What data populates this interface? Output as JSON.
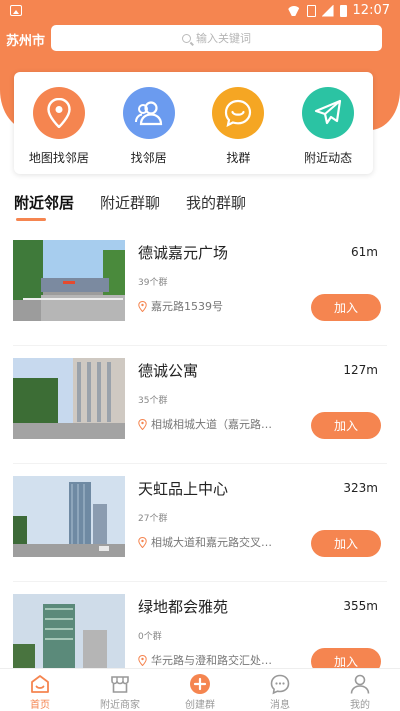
{
  "status": {
    "time": "12:07"
  },
  "header": {
    "city": "苏州市",
    "search_placeholder": "输入关键词"
  },
  "features": [
    {
      "label": "地图找邻居",
      "icon": "map-pin-icon",
      "color": "#f58550"
    },
    {
      "label": "找邻居",
      "icon": "users-icon",
      "color": "#6b9bef"
    },
    {
      "label": "找群",
      "icon": "smile-icon",
      "color": "#f5a623"
    },
    {
      "label": "附近动态",
      "icon": "paper-plane-icon",
      "color": "#2bc3a3"
    }
  ],
  "tabs": [
    {
      "label": "附近邻居",
      "active": true
    },
    {
      "label": "附近群聊",
      "active": false
    },
    {
      "label": "我的群聊",
      "active": false
    }
  ],
  "items": [
    {
      "name": "德诚嘉元广场",
      "distance": "61m",
      "groups": "39个群",
      "address": "嘉元路1539号",
      "join": "加入"
    },
    {
      "name": "德诚公寓",
      "distance": "127m",
      "groups": "35个群",
      "address": "相城相城大道（嘉元路…",
      "join": "加入"
    },
    {
      "name": "天虹品上中心",
      "distance": "323m",
      "groups": "27个群",
      "address": "相城大道和嘉元路交叉…",
      "join": "加入"
    },
    {
      "name": "绿地都会雅苑",
      "distance": "355m",
      "groups": "0个群",
      "address": "华元路与澄和路交汇处…",
      "join": "加入"
    }
  ],
  "nav": [
    {
      "label": "首页",
      "active": true
    },
    {
      "label": "附近商家",
      "active": false
    },
    {
      "label": "创建群",
      "active": false
    },
    {
      "label": "消息",
      "active": false
    },
    {
      "label": "我的",
      "active": false
    }
  ],
  "colors": {
    "accent": "#f58550"
  }
}
